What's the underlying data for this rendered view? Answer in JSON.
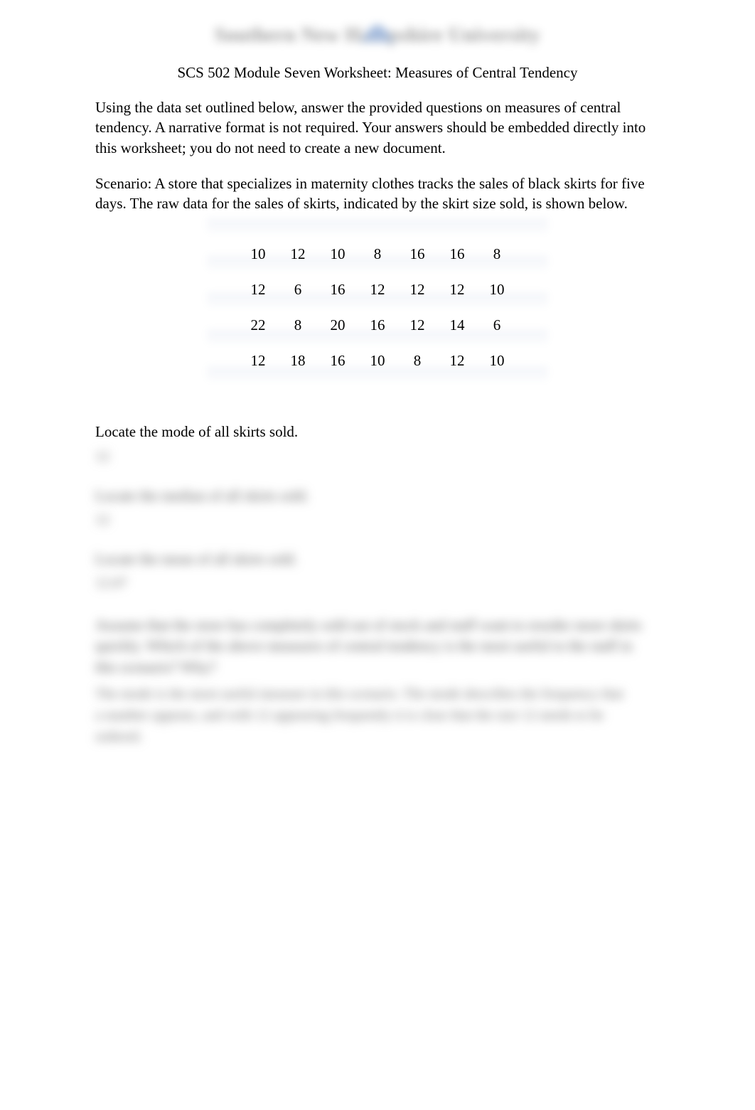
{
  "logo": {
    "text": "Southern New Hampshire University"
  },
  "title": "SCS 502 Module Seven Worksheet: Measures of Central Tendency",
  "intro": "Using the data set outlined below, answer the provided questions on measures of central tendency. A narrative format is not required. Your answers should be embedded directly into this worksheet; you do not need to create a new document.",
  "scenario_label": "Scenario:",
  "scenario_text": " A store that specializes in maternity clothes tracks the sales of black skirts for five days. The raw data for the sales of skirts, indicated by the skirt size sold, is shown below.",
  "data_rows": [
    [
      "10",
      "12",
      "10",
      "8",
      "16",
      "16",
      "8"
    ],
    [
      "12",
      "6",
      "16",
      "12",
      "12",
      "12",
      "10"
    ],
    [
      "22",
      "8",
      "20",
      "16",
      "12",
      "14",
      "6"
    ],
    [
      "12",
      "18",
      "16",
      "10",
      "8",
      "12",
      "10"
    ]
  ],
  "q1": "Locate the mode of all skirts sold.",
  "a1": "12",
  "q2_blur": "Locate the median of all skirts sold.",
  "a2": "12",
  "q3_blur": "Locate the mean of all skirts sold.",
  "a3": "12.07",
  "q4_blur_line1": "Assume that the store has completely sold out of stock and staff want to reorder more skirts",
  "q4_blur_line2": "quickly. Which of the above measures of central tendency is the most useful to the staff in",
  "q4_blur_line3": "this scenario? Why?",
  "a4_line1": "The mode is the most useful measure in this scenario. The mode describes the frequency that",
  "a4_line2": "a number appears, and with 12 appearing frequently it is clear that the size 12 needs to be",
  "a4_line3": "ordered."
}
